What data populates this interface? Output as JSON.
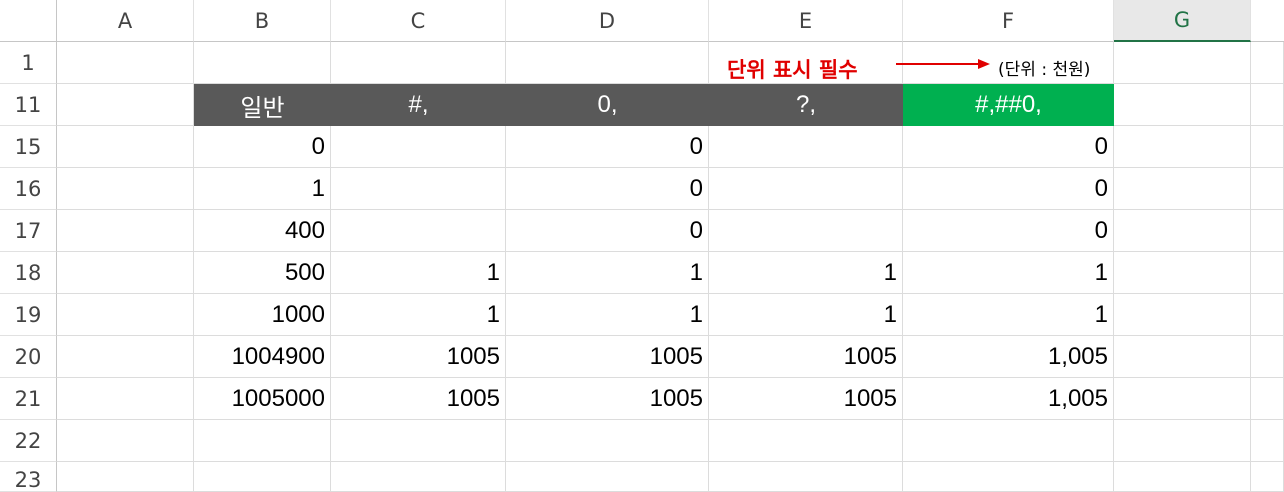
{
  "columns": [
    "A",
    "B",
    "C",
    "D",
    "E",
    "F",
    "G"
  ],
  "selected_column": "G",
  "rows": [
    "1",
    "11",
    "15",
    "16",
    "17",
    "18",
    "19",
    "20",
    "21",
    "22",
    "23"
  ],
  "note": {
    "required_label": "단위 표시 필수",
    "unit_label": "(단위 : 천원)",
    "required_color": "#e00000"
  },
  "header_row": {
    "B": "일반",
    "C": "#,",
    "D": "0,",
    "E": "?,",
    "F": "#,##0,",
    "header_color": "#595959",
    "highlight_color": "#00b050"
  },
  "data_rows": [
    {
      "row": "15",
      "B": "0",
      "C": "",
      "D": "0",
      "E": "",
      "F": "0"
    },
    {
      "row": "16",
      "B": "1",
      "C": "",
      "D": "0",
      "E": "",
      "F": "0"
    },
    {
      "row": "17",
      "B": "400",
      "C": "",
      "D": "0",
      "E": "",
      "F": "0"
    },
    {
      "row": "18",
      "B": "500",
      "C": "1",
      "D": "1",
      "E": "1",
      "F": "1"
    },
    {
      "row": "19",
      "B": "1000",
      "C": "1",
      "D": "1",
      "E": "1",
      "F": "1"
    },
    {
      "row": "20",
      "B": "1004900",
      "C": "1005",
      "D": "1005",
      "E": "1005",
      "F": "1,005"
    },
    {
      "row": "21",
      "B": "1005000",
      "C": "1005",
      "D": "1005",
      "E": "1005",
      "F": "1,005"
    }
  ]
}
